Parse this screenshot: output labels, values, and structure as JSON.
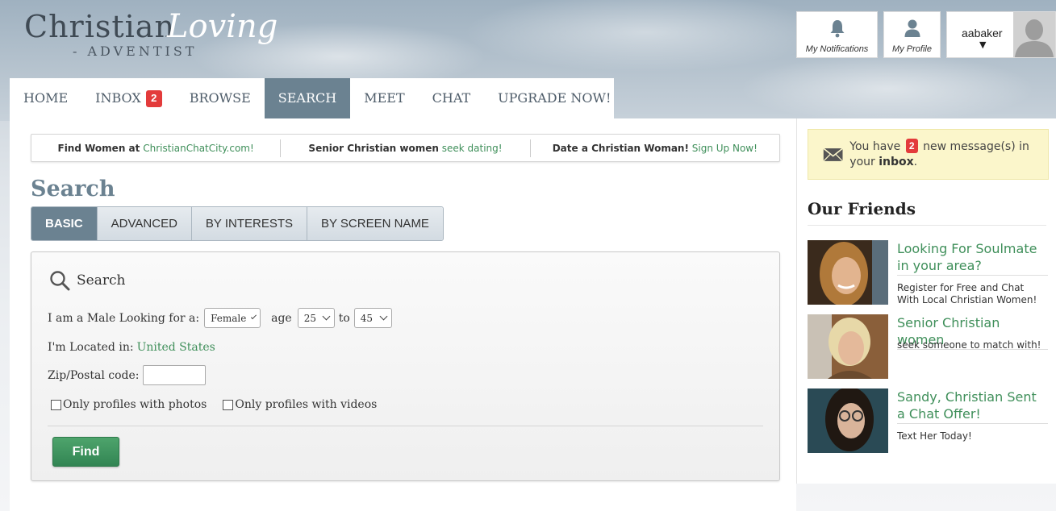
{
  "brand": {
    "name": "Christian",
    "script": "Loving",
    "subtitle": "- ADVENTIST"
  },
  "header": {
    "notifications_label": "My Notifications",
    "profile_label": "My Profile",
    "username": "aabaker",
    "caret": "▼"
  },
  "nav": {
    "items": [
      {
        "label": "HOME"
      },
      {
        "label": "INBOX",
        "badge": "2"
      },
      {
        "label": "BROWSE"
      },
      {
        "label": "SEARCH",
        "active": true
      },
      {
        "label": "MEET"
      },
      {
        "label": "CHAT"
      },
      {
        "label": "UPGRADE NOW!"
      }
    ]
  },
  "ads": [
    {
      "bold": "Find Women at",
      "link": "ChristianChatCity.com!"
    },
    {
      "bold": "Senior Christian women",
      "link": "seek dating!"
    },
    {
      "bold": "Date a Christian Woman!",
      "link": "Sign Up Now!"
    }
  ],
  "page": {
    "title": "Search"
  },
  "tabs": [
    {
      "label": "BASIC",
      "active": true
    },
    {
      "label": "ADVANCED"
    },
    {
      "label": "BY INTERESTS"
    },
    {
      "label": "BY SCREEN NAME"
    }
  ],
  "search_form": {
    "heading": "Search",
    "looking_label": "I am a Male Looking for a:",
    "gender_value": "Female",
    "age_label": "age",
    "age_min": "25",
    "to_label": "to",
    "age_max": "45",
    "location_label": "I'm Located in:",
    "location_value": "United States",
    "zip_label": "Zip/Postal code:",
    "zip_value": "",
    "photos_label": "Only profiles with photos",
    "videos_label": "Only profiles with videos",
    "find_button": "Find"
  },
  "sidebar": {
    "msg_prefix": "You have",
    "msg_count": "2",
    "msg_middle": "new message(s) in your",
    "msg_link": "inbox",
    "msg_suffix": ".",
    "friends_title": "Our Friends",
    "friends": [
      {
        "headline": "Looking For Soulmate in your area?",
        "text": "Register for Free and Chat With Local Christian Women!"
      },
      {
        "headline": "Senior Christian women",
        "text": "seek someone to match with!"
      },
      {
        "headline": "Sandy, Christian Sent a Chat Offer!",
        "text": "Text Her Today!"
      }
    ]
  },
  "colors": {
    "accent": "#6b8291",
    "link_green": "#3f8f5a",
    "badge_red": "#e33b3b",
    "button_green": "#3a8f5c",
    "message_bg": "#fbf6cb"
  }
}
